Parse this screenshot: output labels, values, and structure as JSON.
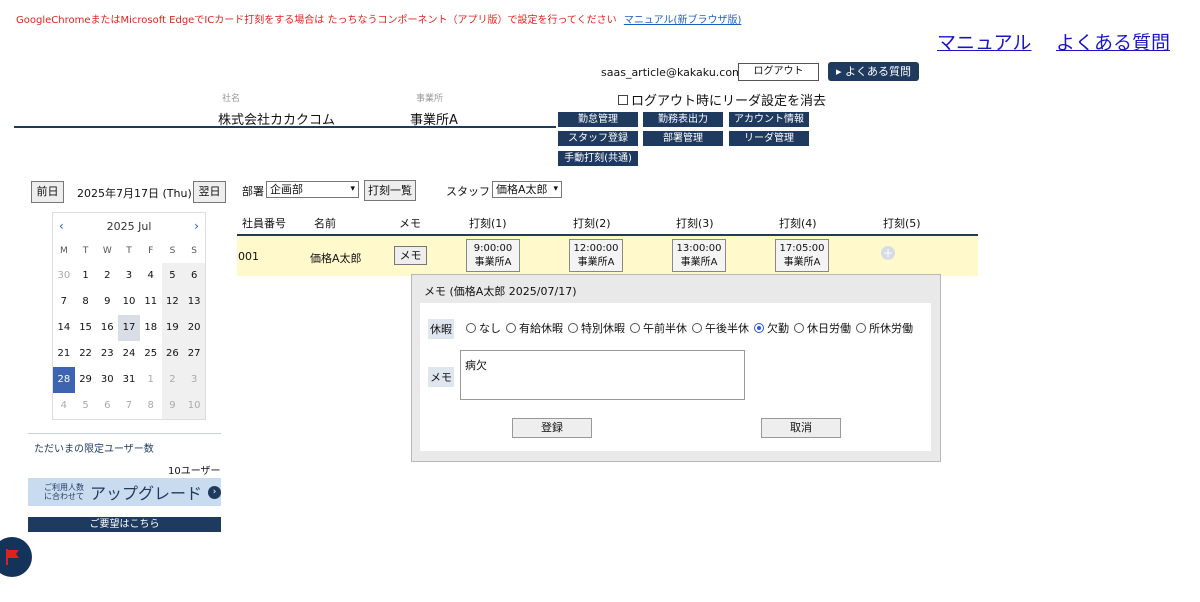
{
  "notice": {
    "text": "GoogleChromeまたはMicrosoft EdgeでICカード打刻をする場合は たっちなうコンポーネント（アプリ版）で設定を行ってください",
    "link": "マニュアル(新ブラウザ版)"
  },
  "header": {
    "manual_link": "マニュアル",
    "faq_link": "よくある質問",
    "email": "saas_article@kakaku.com",
    "logout_button": "ログアウト",
    "faq_button": "よくある質問",
    "clear_checkbox_label": "ログアウト時にリーダ設定を消去",
    "company_caption": "社名",
    "company_value": "株式会社カカクコム",
    "office_caption": "事業所",
    "office_value": "事業所A"
  },
  "nav": [
    "勤怠管理",
    "勤務表出力",
    "アカウント情報",
    "スタッフ登録",
    "部署管理",
    "リーダ管理",
    "手動打刻(共通)"
  ],
  "date_nav": {
    "prev": "前日",
    "current": "2025年7月17日 (Thu)",
    "next": "翌日"
  },
  "calendar": {
    "month": "2025 Jul",
    "weekdays": [
      "M",
      "T",
      "W",
      "T",
      "F",
      "S",
      "S"
    ],
    "weeks": [
      [
        "30",
        "1",
        "2",
        "3",
        "4",
        "5",
        "6"
      ],
      [
        "7",
        "8",
        "9",
        "10",
        "11",
        "12",
        "13"
      ],
      [
        "14",
        "15",
        "16",
        "17",
        "18",
        "19",
        "20"
      ],
      [
        "21",
        "22",
        "23",
        "24",
        "25",
        "26",
        "27"
      ],
      [
        "28",
        "29",
        "30",
        "31",
        "1",
        "2",
        "3"
      ],
      [
        "4",
        "5",
        "6",
        "7",
        "8",
        "9",
        "10"
      ]
    ]
  },
  "sidebar": {
    "limited_users_title": "ただいまの限定ユーザー数",
    "user_count": "10ユーザー",
    "upgrade_small_1": "ご利用人数",
    "upgrade_small_2": "に合わせて",
    "upgrade_big": "アップグレード",
    "request_button": "ご要望はこちら"
  },
  "filters": {
    "dept_label": "部署",
    "dept_value": "企画部",
    "punch_list_button": "打刻一覧",
    "staff_label": "スタッフ",
    "staff_value": "価格A太郎"
  },
  "table": {
    "headers": [
      "社員番号",
      "名前",
      "メモ",
      "打刻(1)",
      "打刻(2)",
      "打刻(3)",
      "打刻(4)",
      "打刻(5)"
    ],
    "row": {
      "id": "001",
      "name": "価格A太郎",
      "memo_button": "メモ",
      "punches": [
        {
          "time": "9:00:00",
          "place": "事業所A"
        },
        {
          "time": "12:00:00",
          "place": "事業所A"
        },
        {
          "time": "13:00:00",
          "place": "事業所A"
        },
        {
          "time": "17:05:00",
          "place": "事業所A"
        }
      ]
    }
  },
  "dialog": {
    "title": "メモ (価格A太郎 2025/07/17)",
    "leave_label": "休暇",
    "leave_options": [
      "なし",
      "有給休暇",
      "特別休暇",
      "午前半休",
      "午後半休",
      "欠勤",
      "休日労働",
      "所休労働"
    ],
    "leave_selected": "欠勤",
    "memo_label": "メモ",
    "memo_value": "病欠",
    "register_button": "登録",
    "cancel_button": "取消"
  },
  "colors": {
    "navy": "#1f3a5f",
    "notice_red": "#e0241b",
    "row_highlight": "#fff9cc",
    "today": "#3d64b0"
  }
}
